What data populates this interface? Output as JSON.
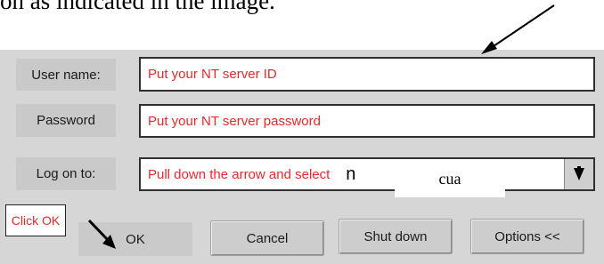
{
  "document": {
    "partial_text": "on as indicated in the image."
  },
  "login": {
    "username_label": "User name:",
    "username_value": "Put your NT server ID",
    "password_label": "Password",
    "password_value": "Put your NT server password",
    "logon_label": "Log on to:",
    "logon_value": "Pull down the arrow and select",
    "logon_overlay_fragment": "n",
    "overlay_text": "cua"
  },
  "buttons": {
    "ok": "OK",
    "cancel": "Cancel",
    "shutdown": "Shut down",
    "options": "Options <<"
  },
  "callout": {
    "text": "Click OK"
  },
  "colors": {
    "annotation_text": "#e8282a",
    "dialog_bg": "#d6d6d6"
  },
  "icons": {
    "dropdown": "triangle-down-icon",
    "pointer_arrow": "arrow-icon"
  }
}
